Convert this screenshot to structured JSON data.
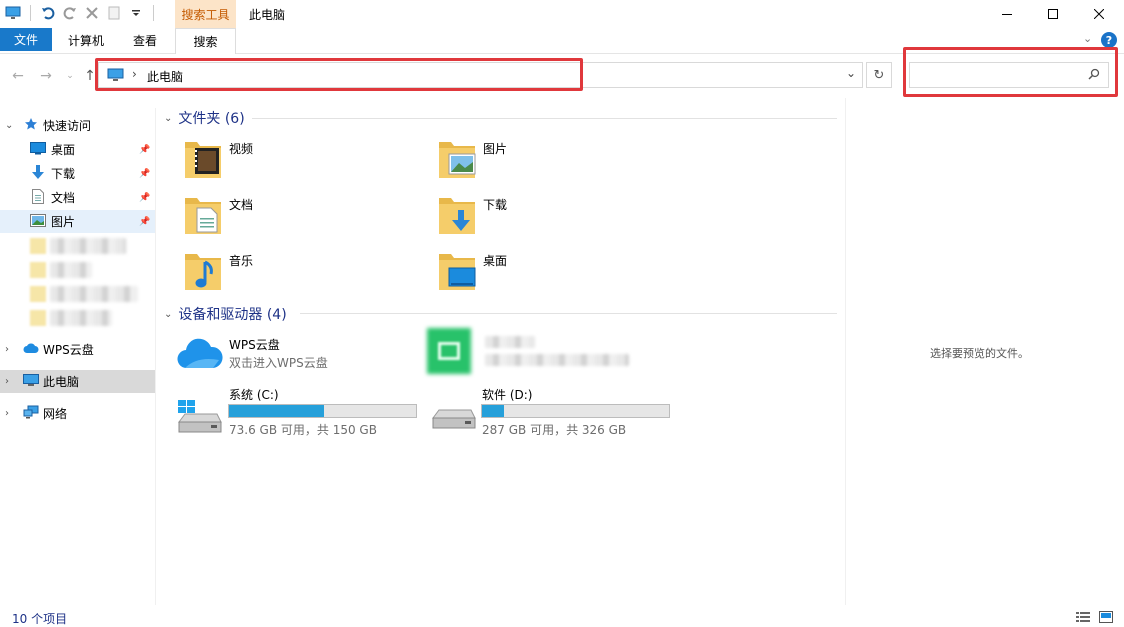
{
  "title": "此电脑",
  "context_tab_header": "搜索工具",
  "ribbon_tabs": [
    "文件",
    "计算机",
    "查看",
    "搜索"
  ],
  "address": {
    "path": "此电脑"
  },
  "search": {
    "value": "",
    "placeholder": ""
  },
  "nav": {
    "quick_access": "快速访问",
    "pinned": [
      "桌面",
      "下载",
      "文档",
      "图片"
    ],
    "wps": "WPS云盘",
    "this_pc": "此电脑",
    "network": "网络"
  },
  "content": {
    "folders_header": "文件夹 (6)",
    "folders": [
      "视频",
      "图片",
      "文档",
      "下载",
      "音乐",
      "桌面"
    ],
    "devices_header": "设备和驱动器 (4)",
    "wps_tile": {
      "name": "WPS云盘",
      "sub": "双击进入WPS云盘"
    },
    "drives": [
      {
        "name": "系统 (C:)",
        "usage": "73.6 GB 可用，共 150 GB",
        "used_fraction": 0.51
      },
      {
        "name": "软件 (D:)",
        "usage": "287 GB 可用，共 326 GB",
        "used_fraction": 0.12
      }
    ]
  },
  "preview_message": "选择要预览的文件。",
  "status": "10 个项目",
  "colors": {
    "accent": "#1979ca",
    "highlight": "#e0383c",
    "drive_bar": "#26a0da"
  }
}
